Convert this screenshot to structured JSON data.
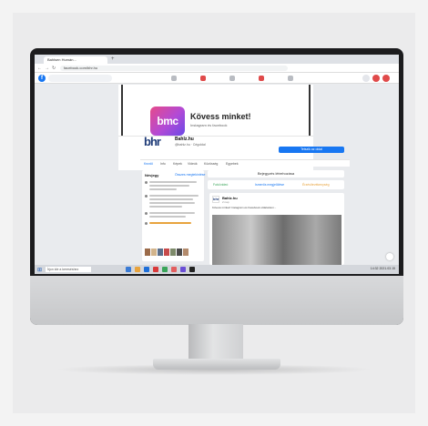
{
  "browser": {
    "tab_title": "Bahlsen Humán...",
    "new_tab_symbol": "+",
    "url": "facebook.com/bhr.hu",
    "nav_back": "←",
    "nav_forward": "→",
    "nav_reload": "↻"
  },
  "facebook": {
    "logo": "f",
    "nav_icons": [
      "home-icon",
      "video-icon",
      "marketplace-icon",
      "groups-icon",
      "gaming-icon"
    ],
    "accent": "#1877f2"
  },
  "cover": {
    "logo_text": "bmc",
    "title": "Kövess minket!",
    "subtitle": "Instagram és facebook"
  },
  "page": {
    "logo_text": "bhr",
    "name": "Bahlz.hu",
    "subtitle": "@bahlz.hu · Cégoldal",
    "like_button": "Tetszik az oldal",
    "tabs": [
      "Kezdő",
      "Info",
      "Képek",
      "Videók",
      "Közösség",
      "Egyebek"
    ]
  },
  "left_column": {
    "title": "Névjegy",
    "link": "Összes megtekintése"
  },
  "right_column": {
    "create_post": "Bejegyzés létrehozása",
    "actions": [
      "Fotó/videó",
      "Ismerős megjelölése",
      "Érzés/tevékenység"
    ]
  },
  "post": {
    "avatar_text": "bhr",
    "author": "Bahlz.hu",
    "time": "2 nap",
    "text": "Kövess minket! Instagram és Facebook oldalunkon..."
  },
  "taskbar": {
    "start_symbol": "⊞",
    "search_placeholder": "Írjon ide a kereséshez",
    "app_colors": [
      "#3a7bd5",
      "#e8a33d",
      "#1e6fd9",
      "#d93a3a",
      "#3aa55a",
      "#e35f5f",
      "#6b4fd6",
      "#222222"
    ],
    "clock": "14:32  2021.03.15"
  }
}
